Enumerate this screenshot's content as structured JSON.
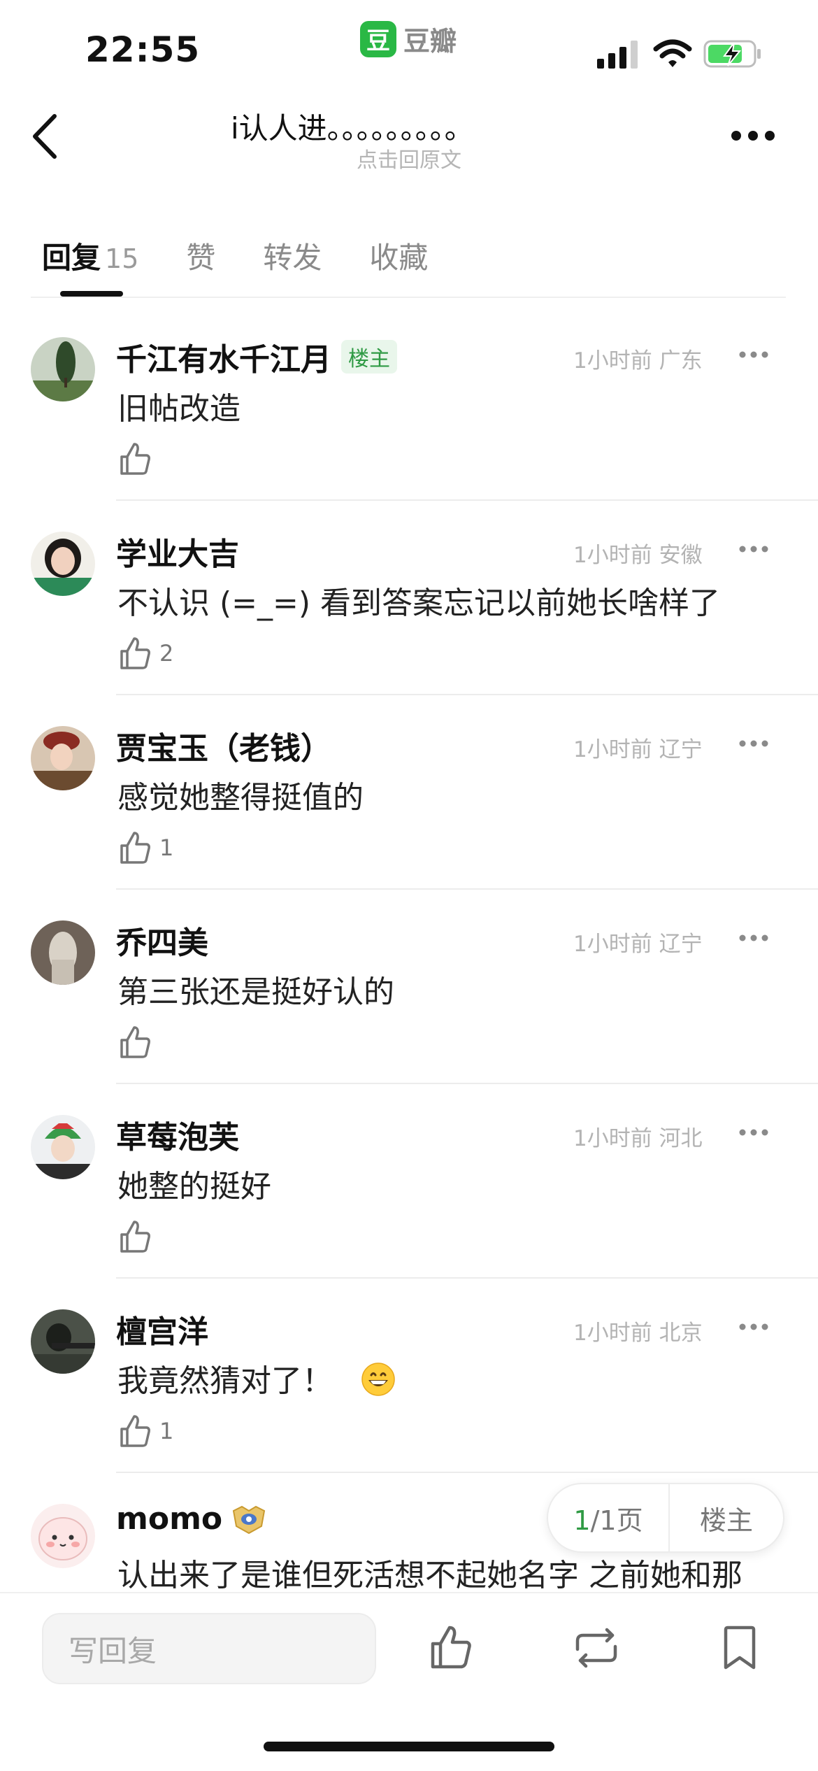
{
  "status_bar": {
    "time": "22:55",
    "app_logo_glyph": "豆",
    "app_name": "豆瓣",
    "icons": [
      "signal-icon",
      "wifi-icon",
      "battery-charging-icon"
    ]
  },
  "nav": {
    "title": "i认人进。。。。。。。。。",
    "subtitle": "点击回原文",
    "icons": [
      "back-icon",
      "more-icon"
    ]
  },
  "tabs": [
    {
      "label": "回复",
      "count": "15",
      "active": true
    },
    {
      "label": "赞",
      "count": "",
      "active": false
    },
    {
      "label": "转发",
      "count": "",
      "active": false
    },
    {
      "label": "收藏",
      "count": "",
      "active": false
    }
  ],
  "comments": [
    {
      "author": "千江有水千江月",
      "badge": "楼主",
      "time": "1小时前",
      "location": "广东",
      "content": "旧帖改造",
      "likes": ""
    },
    {
      "author": "学业大吉",
      "badge": "",
      "time": "1小时前",
      "location": "安徽",
      "content": "不认识 (=_=) 看到答案忘记以前她长啥样了",
      "likes": "2"
    },
    {
      "author": "贾宝玉（老钱）",
      "badge": "",
      "time": "1小时前",
      "location": "辽宁",
      "content": "感觉她整得挺值的",
      "likes": "1"
    },
    {
      "author": "乔四美",
      "badge": "",
      "time": "1小时前",
      "location": "辽宁",
      "content": "第三张还是挺好认的",
      "likes": ""
    },
    {
      "author": "草莓泡芙",
      "badge": "",
      "time": "1小时前",
      "location": "河北",
      "content": "她整的挺好",
      "likes": ""
    },
    {
      "author": "檀宫洋",
      "badge": "",
      "time": "1小时前",
      "location": "北京",
      "content": "我竟然猜对了！",
      "emoji": "grinning-face-icon",
      "likes": "1"
    },
    {
      "author": "momo",
      "badge": "",
      "vip": "vip-badge-icon",
      "time": "",
      "location": "",
      "content": "认出来了是谁但死活想不起她名字 之前她和那",
      "likes": ""
    }
  ],
  "pager": {
    "current": "1",
    "total_label": "/1页",
    "op_label": "楼主"
  },
  "bottom_bar": {
    "reply_placeholder": "写回复",
    "icons": [
      "like-icon",
      "repost-icon",
      "bookmark-icon"
    ]
  },
  "colors": {
    "accent_green": "#2ab845",
    "badge_green": "#2f9a44",
    "meta_gray": "#b3b3b3"
  }
}
